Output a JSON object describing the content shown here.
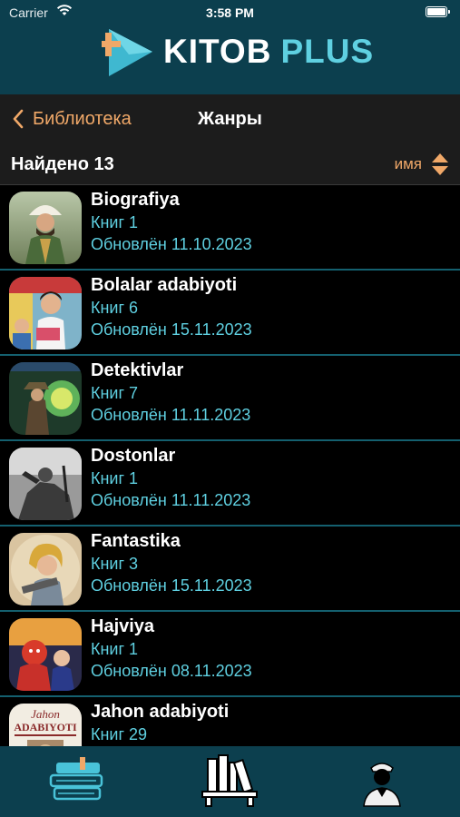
{
  "status_bar": {
    "carrier": "Carrier",
    "time": "3:58 PM"
  },
  "app": {
    "logo_word1": "KITOB",
    "logo_word2": "PLUS"
  },
  "nav": {
    "back_label": "Библиотека",
    "title": "Жанры"
  },
  "filter": {
    "found": "Найдено 13",
    "sort_label": "имя"
  },
  "genres": [
    {
      "name": "Biografiya",
      "count": "Книг 1",
      "updated": "Обновлён 11.10.2023"
    },
    {
      "name": "Bolalar adabiyoti",
      "count": "Книг 6",
      "updated": "Обновлён 15.11.2023"
    },
    {
      "name": "Detektivlar",
      "count": "Книг 7",
      "updated": "Обновлён 11.11.2023"
    },
    {
      "name": "Dostonlar",
      "count": "Книг 1",
      "updated": "Обновлён 11.11.2023"
    },
    {
      "name": "Fantastika",
      "count": "Книг 3",
      "updated": "Обновлён 15.11.2023"
    },
    {
      "name": "Hajviya",
      "count": "Книг 1",
      "updated": "Обновлён 08.11.2023"
    },
    {
      "name": "Jahon adabiyoti",
      "count": "Книг 29",
      "updated": ""
    }
  ],
  "thumb_texts": {
    "jahon_line1": "Jahon",
    "jahon_line2": "ADABIYOTI"
  },
  "tabs": [
    {
      "icon": "books-stack-icon"
    },
    {
      "icon": "bookshelf-icon"
    },
    {
      "icon": "profile-icon"
    }
  ],
  "colors": {
    "header_bg": "#0c3f4e",
    "accent_orange": "#f0a868",
    "accent_cyan": "#5fd0e1",
    "separator": "#14606f"
  }
}
